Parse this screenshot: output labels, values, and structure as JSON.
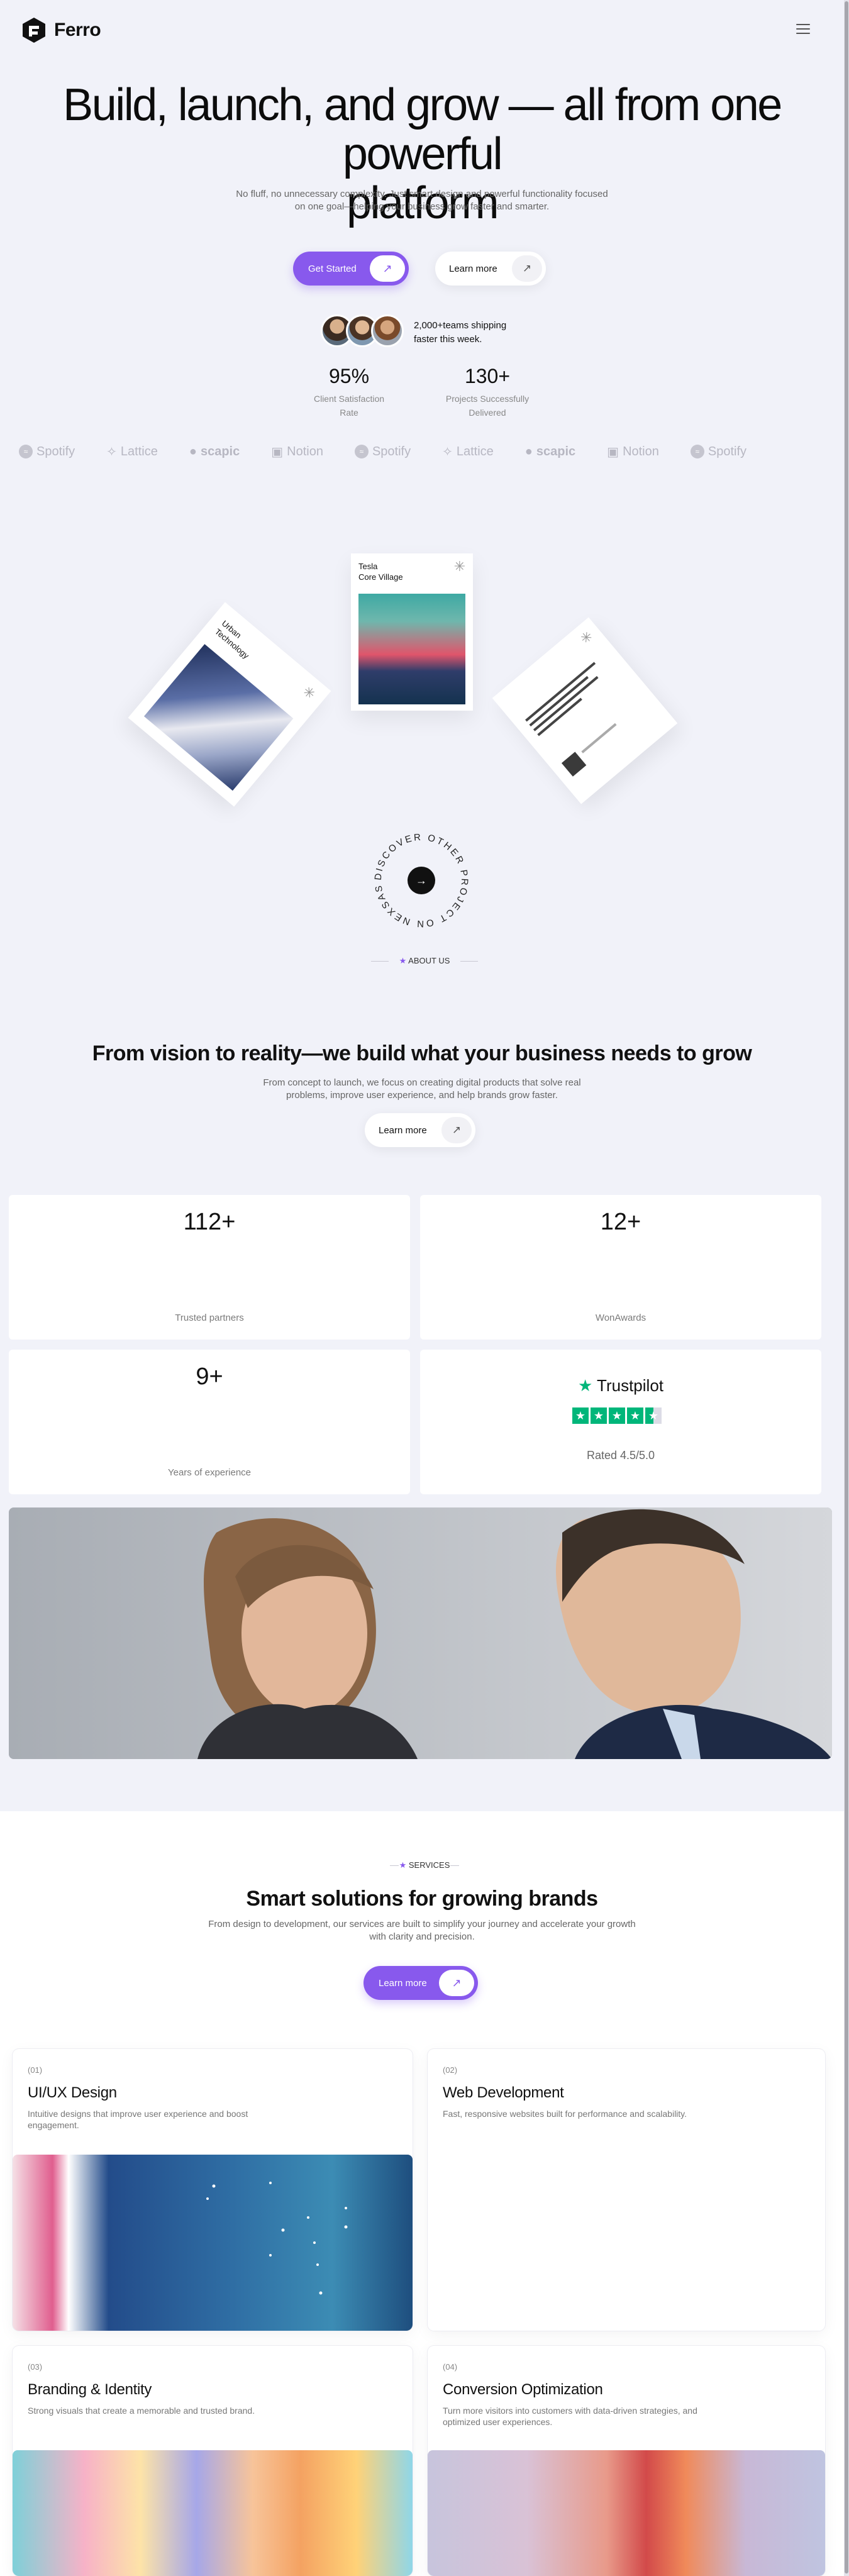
{
  "header": {
    "brand": "Ferro",
    "icons": [
      "ferro-logo-icon",
      "hamburger-menu-icon"
    ]
  },
  "hero": {
    "title_line1": "Build, launch, and grow — all from one powerful",
    "title_line2": "platform",
    "subtitle": "No fluff, no unnecessary complexity. Just smart design and powerful functionality focused on one goal—helping your business grow faster and smarter.",
    "cta_primary": "Get Started",
    "cta_secondary": "Learn more",
    "social_proof": "2,000+teams shipping faster this week.",
    "stats": [
      {
        "value": "95%",
        "label_line1": "Client Satisfaction",
        "label_line2": "Rate"
      },
      {
        "value": "130+",
        "label_line1": "Projects Successfully",
        "label_line2": "Delivered"
      }
    ]
  },
  "logos": [
    "Spotify",
    "Lattice",
    "scapic",
    "Notion",
    "Spotify",
    "Lattice",
    "scapic",
    "Notion",
    "Spotify"
  ],
  "projects": [
    {
      "title_line1": "Urban",
      "title_line2": "Technology"
    },
    {
      "title_line1": "Tesla",
      "title_line2": "Core Village"
    }
  ],
  "discover": {
    "text": "DISCOVER OTHER PROJECT ON NEXSAS • "
  },
  "about": {
    "badge": "ABOUT US",
    "title": "From vision to reality—we build what your business needs to grow",
    "subtitle": "From concept to launch, we focus on creating digital products that solve real problems, improve user experience, and help brands grow faster.",
    "cta": "Learn more"
  },
  "stat_cards": [
    {
      "value": "112+",
      "label": "Trusted partners"
    },
    {
      "value": "12+",
      "label": "WonAwards"
    },
    {
      "value": "9+",
      "label": "Years of experience"
    }
  ],
  "trustpilot": {
    "brand": "Trustpilot",
    "rating": "Rated 4.5/5.0"
  },
  "services": {
    "badge": "SERVICES",
    "title": "Smart solutions for growing brands",
    "subtitle": "From design to development, our services are built to simplify your journey and accelerate your growth with clarity and precision.",
    "cta": "Learn more",
    "items": [
      {
        "index": "(01)",
        "title": "UI/UX Design",
        "desc": "Intuitive designs that improve user experience and boost engagement."
      },
      {
        "index": "(02)",
        "title": "Web Development",
        "desc": "Fast, responsive websites built for performance and scalability."
      },
      {
        "index": "(03)",
        "title": "Branding & Identity",
        "desc": "Strong visuals that create a memorable and trusted brand."
      },
      {
        "index": "(04)",
        "title": "Conversion Optimization",
        "desc": "Turn more visitors into customers with data-driven strategies, and optimized user experiences."
      }
    ]
  },
  "colors": {
    "accent": "#8859ed",
    "page_bg": "#f1f2f9",
    "trustpilot_green": "#00b67a"
  }
}
